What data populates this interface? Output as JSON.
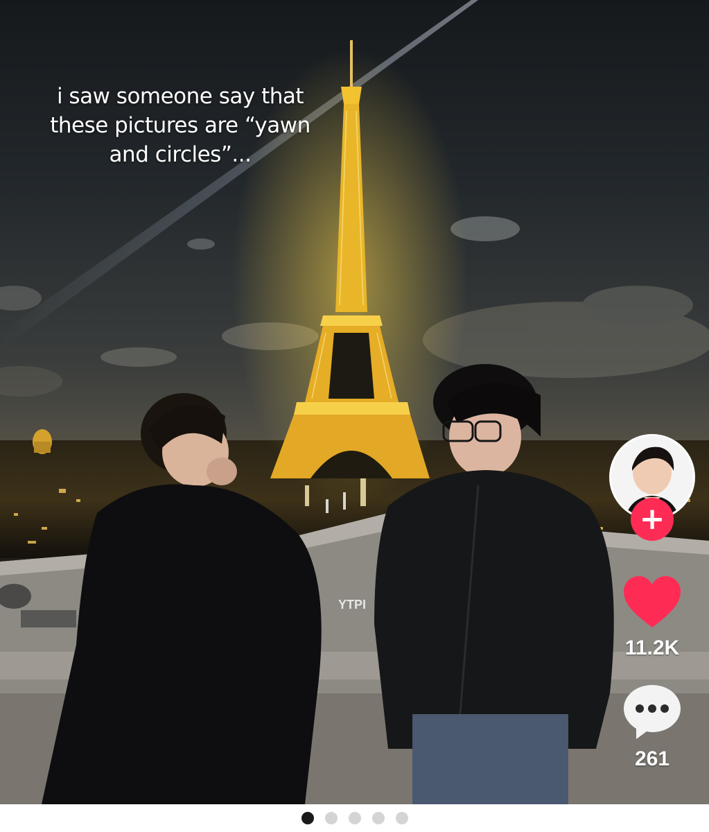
{
  "post": {
    "overlay_text": "i saw someone say that\nthese pictures are “yawn\nand circles”...",
    "graffiti_text": "YTPI\nPA"
  },
  "actions": {
    "follow_symbol": "+",
    "like_count": "11.2K",
    "comment_count": "261"
  },
  "icons": {
    "like": "heart-icon",
    "comment": "speech-bubble-icon",
    "follow": "plus-icon"
  },
  "colors": {
    "accent": "#fe2c55",
    "tower_lights": "#f2c230",
    "dot_active": "#1a1a1a",
    "dot_inactive": "#d4d4d4"
  },
  "carousel": {
    "total": 5,
    "active": 1
  }
}
